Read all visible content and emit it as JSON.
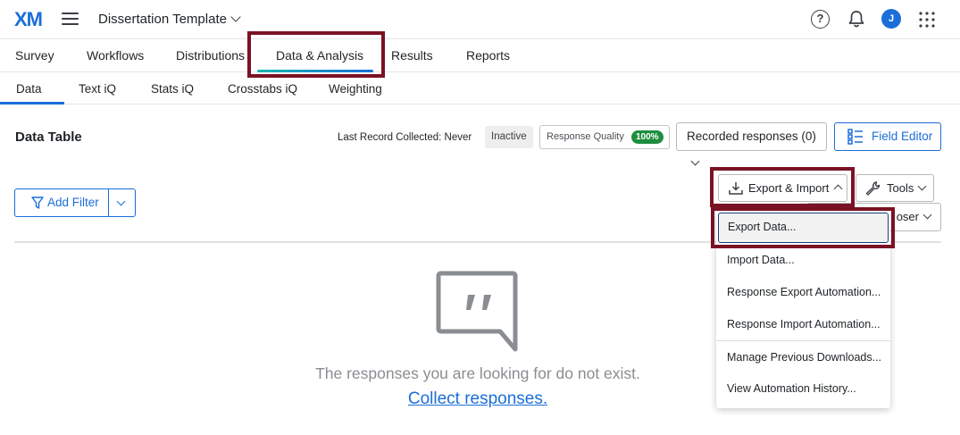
{
  "header": {
    "logo_text": "XM",
    "project_name": "Dissertation Template",
    "avatar_initial": "J"
  },
  "nav": {
    "primary": [
      "Survey",
      "Workflows",
      "Distributions",
      "Data & Analysis",
      "Results",
      "Reports"
    ],
    "active_primary": "Data & Analysis",
    "secondary": [
      "Data",
      "Text iQ",
      "Stats iQ",
      "Crosstabs iQ",
      "Weighting"
    ],
    "active_secondary": "Data"
  },
  "data_table": {
    "title": "Data Table",
    "last_record": "Last Record Collected: Never",
    "status": "Inactive",
    "response_quality_label": "Response Quality",
    "response_quality_value": "100%",
    "recorded_responses": "Recorded responses (0)",
    "field_editor": "Field Editor",
    "add_filter": "Add Filter",
    "export_import": "Export & Import",
    "tools": "Tools",
    "chooser_partial": "oser"
  },
  "dropdown": {
    "items": [
      "Export Data...",
      "Import Data...",
      "Response Export Automation...",
      "Response Import Automation...",
      "Manage Previous Downloads...",
      "View Automation History..."
    ]
  },
  "empty_state": {
    "message": "The responses you are looking for do not exist.",
    "link": "Collect responses."
  },
  "colors": {
    "brand_blue": "#1b6ed8",
    "highlight": "#7a1224",
    "badge_green": "#1e8e3e"
  }
}
